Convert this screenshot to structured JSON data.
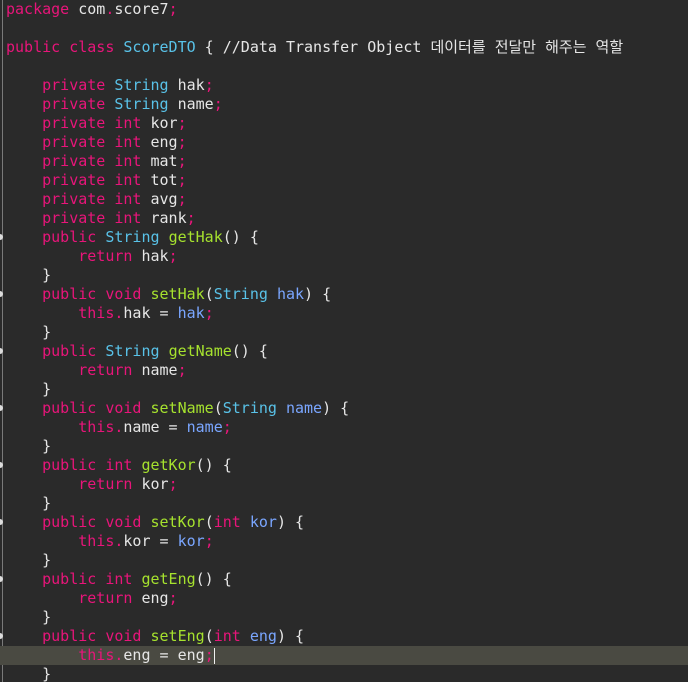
{
  "editor": {
    "language": "java",
    "current_line": 34,
    "lines": [
      [
        [
          "kw",
          "package"
        ],
        [
          "tx",
          " com"
        ],
        [
          "pn",
          "."
        ],
        [
          "tx",
          "score7"
        ],
        [
          "pn",
          ";"
        ]
      ],
      [],
      [
        [
          "kw",
          "public"
        ],
        [
          "tx",
          " "
        ],
        [
          "kw",
          "class"
        ],
        [
          "tx",
          " "
        ],
        [
          "ty",
          "ScoreDTO"
        ],
        [
          "tx",
          " { "
        ],
        [
          "cm",
          "//Data Transfer Object 데이터를 전달만 해주는 역할"
        ]
      ],
      [],
      [
        [
          "tx",
          "    "
        ],
        [
          "kw",
          "private"
        ],
        [
          "tx",
          " "
        ],
        [
          "ty",
          "String"
        ],
        [
          "tx",
          " hak"
        ],
        [
          "pn",
          ";"
        ]
      ],
      [
        [
          "tx",
          "    "
        ],
        [
          "kw",
          "private"
        ],
        [
          "tx",
          " "
        ],
        [
          "ty",
          "String"
        ],
        [
          "tx",
          " name"
        ],
        [
          "pn",
          ";"
        ]
      ],
      [
        [
          "tx",
          "    "
        ],
        [
          "kw",
          "private"
        ],
        [
          "tx",
          " "
        ],
        [
          "kw",
          "int"
        ],
        [
          "tx",
          " kor"
        ],
        [
          "pn",
          ";"
        ]
      ],
      [
        [
          "tx",
          "    "
        ],
        [
          "kw",
          "private"
        ],
        [
          "tx",
          " "
        ],
        [
          "kw",
          "int"
        ],
        [
          "tx",
          " eng"
        ],
        [
          "pn",
          ";"
        ]
      ],
      [
        [
          "tx",
          "    "
        ],
        [
          "kw",
          "private"
        ],
        [
          "tx",
          " "
        ],
        [
          "kw",
          "int"
        ],
        [
          "tx",
          " mat"
        ],
        [
          "pn",
          ";"
        ]
      ],
      [
        [
          "tx",
          "    "
        ],
        [
          "kw",
          "private"
        ],
        [
          "tx",
          " "
        ],
        [
          "kw",
          "int"
        ],
        [
          "tx",
          " tot"
        ],
        [
          "pn",
          ";"
        ]
      ],
      [
        [
          "tx",
          "    "
        ],
        [
          "kw",
          "private"
        ],
        [
          "tx",
          " "
        ],
        [
          "kw",
          "int"
        ],
        [
          "tx",
          " avg"
        ],
        [
          "pn",
          ";"
        ]
      ],
      [
        [
          "tx",
          "    "
        ],
        [
          "kw",
          "private"
        ],
        [
          "tx",
          " "
        ],
        [
          "kw",
          "int"
        ],
        [
          "tx",
          " rank"
        ],
        [
          "pn",
          ";"
        ]
      ],
      [
        [
          "tx",
          "    "
        ],
        [
          "kw",
          "public"
        ],
        [
          "tx",
          " "
        ],
        [
          "ty",
          "String"
        ],
        [
          "tx",
          " "
        ],
        [
          "fn",
          "getHak"
        ],
        [
          "tx",
          "() {"
        ]
      ],
      [
        [
          "tx",
          "        "
        ],
        [
          "kw",
          "return"
        ],
        [
          "tx",
          " hak"
        ],
        [
          "pn",
          ";"
        ]
      ],
      [
        [
          "tx",
          "    }"
        ]
      ],
      [
        [
          "tx",
          "    "
        ],
        [
          "kw",
          "public"
        ],
        [
          "tx",
          " "
        ],
        [
          "kw",
          "void"
        ],
        [
          "tx",
          " "
        ],
        [
          "fn",
          "setHak"
        ],
        [
          "tx",
          "("
        ],
        [
          "ty",
          "String"
        ],
        [
          "tx",
          " "
        ],
        [
          "pa",
          "hak"
        ],
        [
          "tx",
          ") {"
        ]
      ],
      [
        [
          "tx",
          "        "
        ],
        [
          "kw",
          "this"
        ],
        [
          "pn",
          "."
        ],
        [
          "tx",
          "hak = "
        ],
        [
          "pa",
          "hak"
        ],
        [
          "pn",
          ";"
        ]
      ],
      [
        [
          "tx",
          "    }"
        ]
      ],
      [
        [
          "tx",
          "    "
        ],
        [
          "kw",
          "public"
        ],
        [
          "tx",
          " "
        ],
        [
          "ty",
          "String"
        ],
        [
          "tx",
          " "
        ],
        [
          "fn",
          "getName"
        ],
        [
          "tx",
          "() {"
        ]
      ],
      [
        [
          "tx",
          "        "
        ],
        [
          "kw",
          "return"
        ],
        [
          "tx",
          " name"
        ],
        [
          "pn",
          ";"
        ]
      ],
      [
        [
          "tx",
          "    }"
        ]
      ],
      [
        [
          "tx",
          "    "
        ],
        [
          "kw",
          "public"
        ],
        [
          "tx",
          " "
        ],
        [
          "kw",
          "void"
        ],
        [
          "tx",
          " "
        ],
        [
          "fn",
          "setName"
        ],
        [
          "tx",
          "("
        ],
        [
          "ty",
          "String"
        ],
        [
          "tx",
          " "
        ],
        [
          "pa",
          "name"
        ],
        [
          "tx",
          ") {"
        ]
      ],
      [
        [
          "tx",
          "        "
        ],
        [
          "kw",
          "this"
        ],
        [
          "pn",
          "."
        ],
        [
          "tx",
          "name = "
        ],
        [
          "pa",
          "name"
        ],
        [
          "pn",
          ";"
        ]
      ],
      [
        [
          "tx",
          "    }"
        ]
      ],
      [
        [
          "tx",
          "    "
        ],
        [
          "kw",
          "public"
        ],
        [
          "tx",
          " "
        ],
        [
          "kw",
          "int"
        ],
        [
          "tx",
          " "
        ],
        [
          "fn",
          "getKor"
        ],
        [
          "tx",
          "() {"
        ]
      ],
      [
        [
          "tx",
          "        "
        ],
        [
          "kw",
          "return"
        ],
        [
          "tx",
          " kor"
        ],
        [
          "pn",
          ";"
        ]
      ],
      [
        [
          "tx",
          "    }"
        ]
      ],
      [
        [
          "tx",
          "    "
        ],
        [
          "kw",
          "public"
        ],
        [
          "tx",
          " "
        ],
        [
          "kw",
          "void"
        ],
        [
          "tx",
          " "
        ],
        [
          "fn",
          "setKor"
        ],
        [
          "tx",
          "("
        ],
        [
          "kw",
          "int"
        ],
        [
          "tx",
          " "
        ],
        [
          "pa",
          "kor"
        ],
        [
          "tx",
          ") {"
        ]
      ],
      [
        [
          "tx",
          "        "
        ],
        [
          "kw",
          "this"
        ],
        [
          "pn",
          "."
        ],
        [
          "tx",
          "kor = "
        ],
        [
          "pa",
          "kor"
        ],
        [
          "pn",
          ";"
        ]
      ],
      [
        [
          "tx",
          "    }"
        ]
      ],
      [
        [
          "tx",
          "    "
        ],
        [
          "kw",
          "public"
        ],
        [
          "tx",
          " "
        ],
        [
          "kw",
          "int"
        ],
        [
          "tx",
          " "
        ],
        [
          "fn",
          "getEng"
        ],
        [
          "tx",
          "() {"
        ]
      ],
      [
        [
          "tx",
          "        "
        ],
        [
          "kw",
          "return"
        ],
        [
          "tx",
          " eng"
        ],
        [
          "pn",
          ";"
        ]
      ],
      [
        [
          "tx",
          "    }"
        ]
      ],
      [
        [
          "tx",
          "    "
        ],
        [
          "kw",
          "public"
        ],
        [
          "tx",
          " "
        ],
        [
          "kw",
          "void"
        ],
        [
          "tx",
          " "
        ],
        [
          "fn",
          "setEng"
        ],
        [
          "tx",
          "("
        ],
        [
          "kw",
          "int"
        ],
        [
          "tx",
          " "
        ],
        [
          "pa",
          "eng"
        ],
        [
          "tx",
          ") {"
        ]
      ],
      [
        [
          "tx",
          "        "
        ],
        [
          "kw",
          "this"
        ],
        [
          "pn",
          "."
        ],
        [
          "tx",
          "eng = eng"
        ],
        [
          "pn",
          ";"
        ]
      ],
      [
        [
          "tx",
          "    }"
        ]
      ]
    ],
    "method_marker_lines": [
      12,
      15,
      18,
      21,
      24,
      27,
      30,
      33
    ],
    "colors": {
      "background": "#2a2a2a",
      "current_line": "#4a4a42",
      "keyword": "#e8157a",
      "type": "#59c2e8",
      "method": "#a6e22e",
      "parameter": "#7aa6ff",
      "text": "#e6e6e6"
    }
  }
}
